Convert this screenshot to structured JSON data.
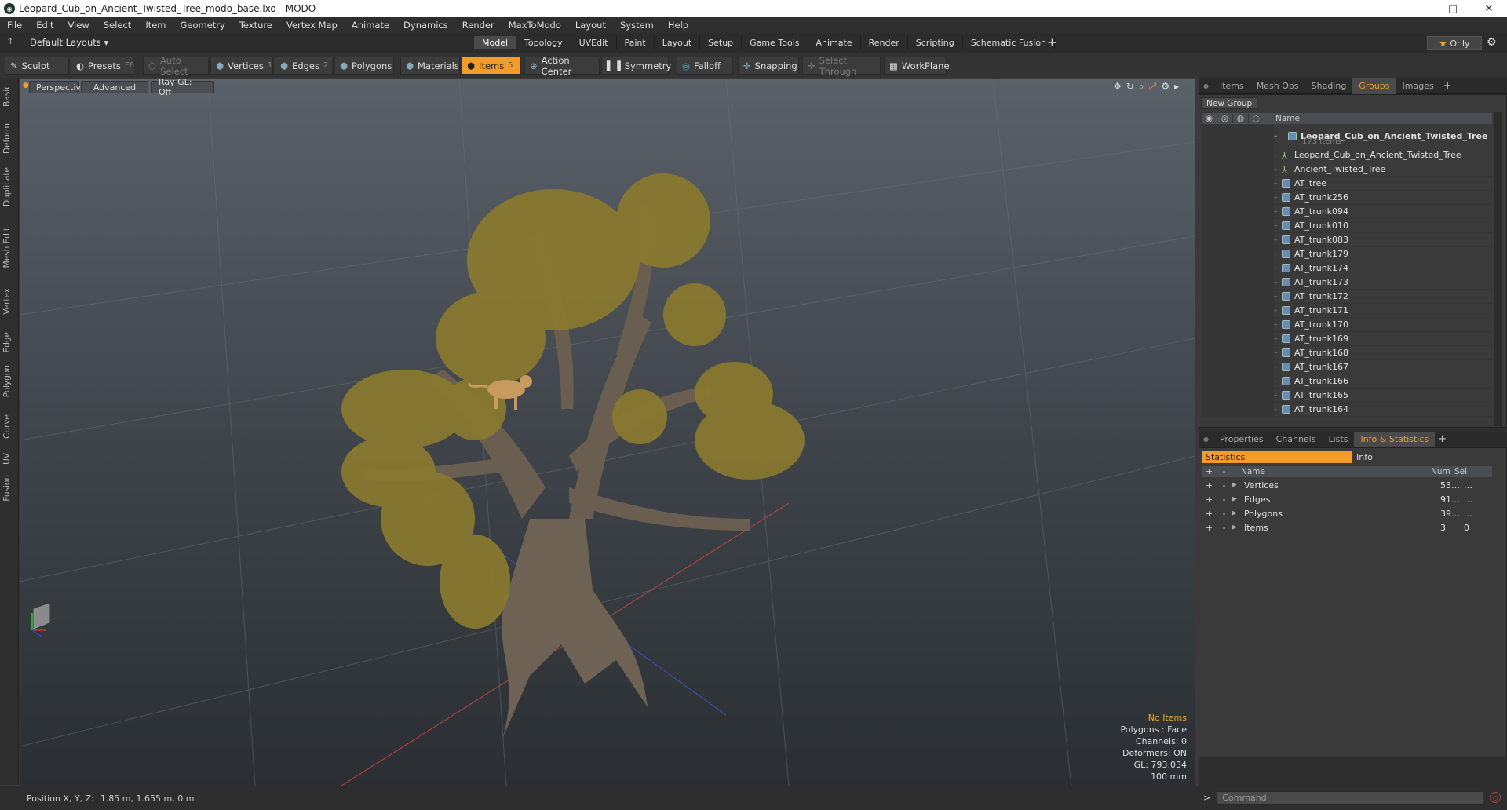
{
  "window": {
    "title": "Leopard_Cub_on_Ancient_Twisted_Tree_modo_base.lxo - MODO",
    "min": "–",
    "max": "▢",
    "close": "✕"
  },
  "menu": [
    "File",
    "Edit",
    "View",
    "Select",
    "Item",
    "Geometry",
    "Texture",
    "Vertex Map",
    "Animate",
    "Dynamics",
    "Render",
    "MaxToModo",
    "Layout",
    "System",
    "Help"
  ],
  "layout": {
    "selector": "Default Layouts ▾",
    "tabs": [
      "Model",
      "Topology",
      "UVEdit",
      "Paint",
      "Layout",
      "Setup",
      "Game Tools",
      "Animate",
      "Render",
      "Scripting",
      "Schematic Fusion"
    ],
    "active_tab": "Model",
    "only": "Only"
  },
  "toolbar": {
    "sculpt": "Sculpt",
    "presets": "Presets",
    "presets_key": "F6",
    "auto_select": "Auto Select",
    "vertices": "Vertices",
    "vertices_key": "1",
    "edges": "Edges",
    "edges_key": "2",
    "polygons": "Polygons",
    "materials": "Materials",
    "items": "Items",
    "items_key": "5",
    "action_center": "Action Center",
    "symmetry": "Symmetry",
    "falloff": "Falloff",
    "snapping": "Snapping",
    "select_through": "Select Through",
    "workplane": "WorkPlane"
  },
  "left_tabs": [
    "Basic",
    "Deform",
    "Duplicate",
    "Mesh Edit",
    "Vertex",
    "Edge",
    "Polygon",
    "Curve",
    "UV",
    "Fusion"
  ],
  "viewport": {
    "view": "Perspective",
    "shading": "Advanced",
    "raygl": "Ray GL: Off",
    "info": {
      "no_items": "No Items",
      "polygons": "Polygons : Face",
      "channels": "Channels: 0",
      "deformers": "Deformers: ON",
      "gl": "GL: 793,034",
      "scale": "100 mm"
    }
  },
  "status": {
    "label": "Position X, Y, Z:",
    "value": "1.85 m, 1.655 m, 0 m"
  },
  "groups_panel": {
    "tabs": [
      "Items",
      "Mesh Ops",
      "Shading",
      "Groups",
      "Images"
    ],
    "active_tab": "Groups",
    "new_group": "New Group",
    "col_name": "Name",
    "root": "Leopard_Cub_on_Ancient_Twisted_Tree",
    "root_count": "173 Items",
    "items": [
      {
        "name": "Leopard_Cub_on_Ancient_Twisted_Tree",
        "icon": "locator"
      },
      {
        "name": "Ancient_Twisted_Tree",
        "icon": "locator"
      },
      {
        "name": "AT_tree",
        "icon": "mesh"
      },
      {
        "name": "AT_trunk256",
        "icon": "mesh"
      },
      {
        "name": "AT_trunk094",
        "icon": "mesh"
      },
      {
        "name": "AT_trunk010",
        "icon": "mesh"
      },
      {
        "name": "AT_trunk083",
        "icon": "mesh"
      },
      {
        "name": "AT_trunk179",
        "icon": "mesh"
      },
      {
        "name": "AT_trunk174",
        "icon": "mesh"
      },
      {
        "name": "AT_trunk173",
        "icon": "mesh"
      },
      {
        "name": "AT_trunk172",
        "icon": "mesh"
      },
      {
        "name": "AT_trunk171",
        "icon": "mesh"
      },
      {
        "name": "AT_trunk170",
        "icon": "mesh"
      },
      {
        "name": "AT_trunk169",
        "icon": "mesh"
      },
      {
        "name": "AT_trunk168",
        "icon": "mesh"
      },
      {
        "name": "AT_trunk167",
        "icon": "mesh"
      },
      {
        "name": "AT_trunk166",
        "icon": "mesh"
      },
      {
        "name": "AT_trunk165",
        "icon": "mesh"
      },
      {
        "name": "AT_trunk164",
        "icon": "mesh"
      }
    ]
  },
  "info_panel": {
    "tabs": [
      "Properties",
      "Channels",
      "Lists",
      "Info & Statistics"
    ],
    "active_tab": "Info & Statistics",
    "subtabs": [
      "Statistics",
      "Info"
    ],
    "col_name": "Name",
    "col_num": "Num",
    "col_sel": "Sel",
    "rows": [
      {
        "name": "Vertices",
        "num": "53…",
        "sel": "…"
      },
      {
        "name": "Edges",
        "num": "91…",
        "sel": "…"
      },
      {
        "name": "Polygons",
        "num": "39…",
        "sel": "…"
      },
      {
        "name": "Items",
        "num": "3",
        "sel": "0"
      }
    ]
  },
  "command": {
    "prompt": ">",
    "placeholder": "Command"
  },
  "colors": {
    "accent": "#f39c2a",
    "panel": "#3a3a3a"
  }
}
